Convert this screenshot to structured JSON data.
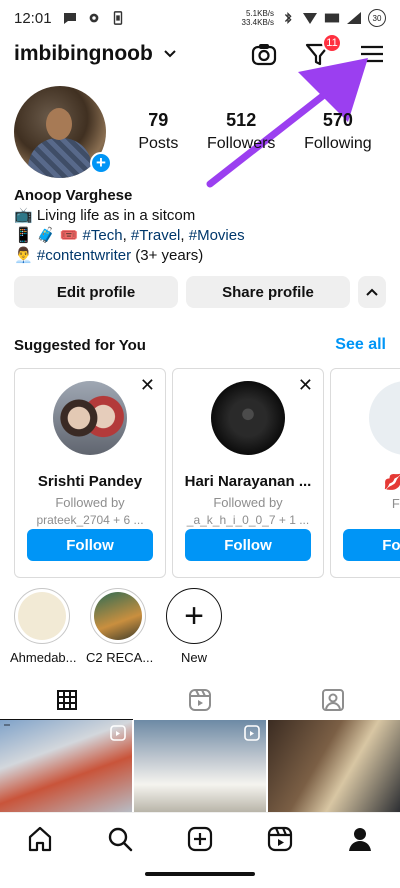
{
  "status_bar": {
    "time": "12:01",
    "net_up": "5.1KB/s",
    "net_down": "33.4KB/s",
    "battery": "30"
  },
  "header": {
    "username": "imbibingnoob",
    "notification_count": "11"
  },
  "profile": {
    "stats": [
      {
        "value": "79",
        "label": "Posts"
      },
      {
        "value": "512",
        "label": "Followers"
      },
      {
        "value": "570",
        "label": "Following"
      }
    ],
    "name": "Anoop Varghese",
    "bio_line1": "📺 Living life as in a sitcom",
    "bio_line2_emoji": "📱 🧳 🎟️ ",
    "bio_tags": [
      "#Tech",
      "#Travel",
      "#Movies"
    ],
    "bio_line3_emoji": "👨‍💼 ",
    "bio_line3_tag": "#contentwriter",
    "bio_line3_text": " (3+ years)"
  },
  "actions": {
    "edit_profile": "Edit profile",
    "share_profile": "Share profile",
    "expand": "^"
  },
  "suggested": {
    "title": "Suggested for You",
    "see_all": "See all",
    "cards": [
      {
        "name": "Srishti Pandey",
        "followed_by_label": "Followed by",
        "followed_by": "prateek_2704 + 6 ...",
        "button": "Follow"
      },
      {
        "name": "Hari Narayanan ...",
        "followed_by_label": "Followed by",
        "followed_by": "_a_k_h_i_0_0_7 + 1 ...",
        "button": "Follow"
      },
      {
        "name": "💋◯ɓ",
        "followed_by_label": "Follo",
        "followed_by": "",
        "button": "Follow"
      }
    ]
  },
  "highlights": [
    {
      "label": "Ahmedab..."
    },
    {
      "label": "C2 RECA..."
    },
    {
      "label": "New"
    }
  ],
  "colors": {
    "accent": "#0095f6",
    "badge": "#ff3040",
    "annotation_arrow": "#9b3ff0"
  }
}
